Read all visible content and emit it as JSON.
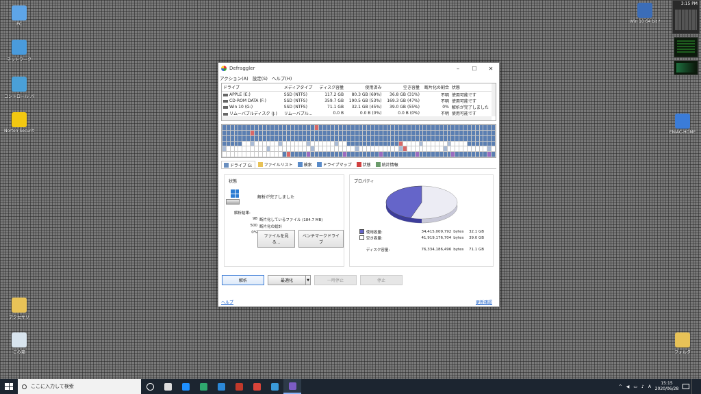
{
  "desktop": {
    "left_icons": [
      {
        "label": "PC",
        "color": "#5ea5e8"
      },
      {
        "label": "ネットワーク",
        "color": "#4a9bdc"
      },
      {
        "label": "コントロール パネル",
        "color": "#4aa0d8"
      },
      {
        "label": "Norton Security",
        "color": "#f2c811"
      },
      {
        "label": "アクセサリ",
        "color": "#e8c257"
      },
      {
        "label": "ごみ箱",
        "color": "#d8e4ee"
      }
    ],
    "right_icons": [
      {
        "label": "Win 10 64 bit Mar 2020",
        "color": "#3b6db8"
      },
      {
        "label": "ENIAC-HOME",
        "color": "#3b7cd8"
      },
      {
        "label": "フォルダ",
        "color": "#e8c257"
      }
    ],
    "clock_widget_time": "3:15 PM"
  },
  "window": {
    "title": "Defraggler",
    "menu": [
      "アクション(A)",
      "設定(S)",
      "ヘルプ(H)"
    ],
    "controls": [
      "–",
      "☐",
      "✕"
    ],
    "drive_table": {
      "headers": [
        "ドライブ",
        "メディアタイプ",
        "ディスク容量",
        "使用済み",
        "空き容量",
        "断片化の割合",
        "状態"
      ],
      "rows": [
        [
          "APPLE (E:)",
          "SSD (NTFS)",
          "117.2 GB",
          "80.3 GB (69%)",
          "36.8 GB (31%)",
          "不明",
          "使用可能です"
        ],
        [
          "CD-ROM DATA (F:)",
          "SSD (NTFS)",
          "359.7 GB",
          "190.5 GB (53%)",
          "169.3 GB (47%)",
          "不明",
          "使用可能です"
        ],
        [
          "Win 10 (G:)",
          "SSD (NTFS)",
          "71.1 GB",
          "32.1 GB (45%)",
          "39.0 GB (55%)",
          "0%",
          "解析が完了しました"
        ],
        [
          "リムーバブルディスク (J:)",
          "リムーバブル...",
          "0.0 B",
          "0.0 B (0%)",
          "0.0 B (0%)",
          "不明",
          "使用可能です"
        ]
      ]
    },
    "tabs": [
      {
        "label": "ドライブ G:",
        "icon": "drive-icon",
        "color": "#6a8fbf"
      },
      {
        "label": "ファイルリスト",
        "icon": "file-list-icon",
        "color": "#e8c257"
      },
      {
        "label": "検索",
        "icon": "search-icon",
        "color": "#5a8bc8"
      },
      {
        "label": "ドライブマップ",
        "icon": "drive-map-icon",
        "color": "#5a8bc8"
      },
      {
        "label": "状態",
        "icon": "status-icon",
        "color": "#d04040"
      },
      {
        "label": "統計情報",
        "icon": "stats-icon",
        "color": "#6a9a6a"
      }
    ],
    "status_panel": {
      "heading": "状態",
      "message": "解析が完了しました",
      "results_label": "解析結果:",
      "results": [
        {
          "num": "98",
          "text": "断片化しているファイル (184.7 MB)"
        },
        {
          "num": "500",
          "text": "断片化の総計"
        },
        {
          "num": "0%",
          "text": "断片化の割合"
        }
      ],
      "view_files_button": "ファイルを見る...",
      "benchmark_button": "ベンチマークドライブ"
    },
    "properties_panel": {
      "heading": "プロパティ",
      "used": {
        "label": "使用容量:",
        "bytes": "34,415,009,792",
        "unit": "bytes",
        "gb": "32.1 GB",
        "color": "#6565c9"
      },
      "free": {
        "label": "空き容量:",
        "bytes": "41,919,176,704",
        "unit": "bytes",
        "gb": "39.0 GB",
        "color": "#ececf4"
      },
      "total": {
        "label": "ディスク容量:",
        "bytes": "76,334,186,496",
        "unit": "bytes",
        "gb": "71.1 GB"
      },
      "used_fraction": 0.45
    },
    "actions": {
      "analyze": "解析",
      "defrag": "最適化",
      "pause": "一時停止",
      "stop": "停止"
    },
    "footer": {
      "help": "ヘルプ",
      "update": "更新確認"
    }
  },
  "taskbar": {
    "search_placeholder": "ここに入力して検索",
    "apps": [
      {
        "name": "cortana",
        "color": "#ffffff"
      },
      {
        "name": "task-view",
        "color": "#dddddd"
      },
      {
        "name": "ie",
        "color": "#1e90ff"
      },
      {
        "name": "edge",
        "color": "#2fa86e"
      },
      {
        "name": "mail",
        "color": "#2b88d8"
      },
      {
        "name": "norton",
        "color": "#c0392b"
      },
      {
        "name": "media",
        "color": "#d9443a"
      },
      {
        "name": "store",
        "color": "#3a9ad9"
      },
      {
        "name": "defraggler",
        "color": "#7c5cc4"
      }
    ],
    "tray_items": [
      "^",
      "◀",
      "▭",
      "♪",
      "A"
    ],
    "time": "15:15",
    "date": "2020/06/28"
  }
}
